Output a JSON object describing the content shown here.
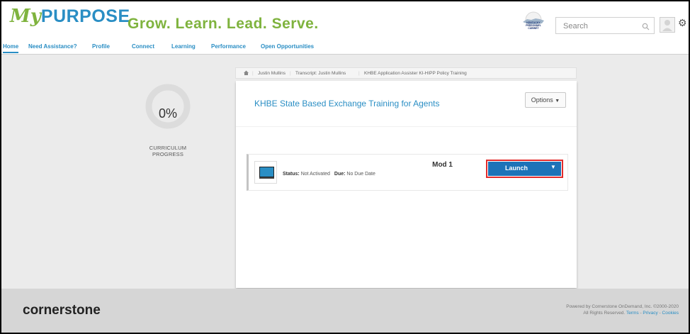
{
  "header": {
    "logo_my": "My",
    "logo_purpose": "PURPOSE",
    "tagline": "Grow. Learn. Lead. Serve.",
    "seal_text": [
      "KENTUCKY",
      "PERSONNEL",
      "CABINET"
    ],
    "search_placeholder": "Search"
  },
  "nav": [
    "Home",
    "Need Assistance?",
    "Profile",
    "Connect",
    "Learning",
    "Performance",
    "Open Opportunities"
  ],
  "progress": {
    "value": "0%",
    "label": "CURRICULUM PROGRESS"
  },
  "breadcrumb": [
    "Justin Mullins",
    "Transcript: Justin Mullins",
    "KHBE Application Assister KI-HIPP Policy Training"
  ],
  "card": {
    "title": "KHBE State Based Exchange Training for Agents",
    "options_label": "Options"
  },
  "module": {
    "name": "Mod 1",
    "status_label": "Status:",
    "status_value": "Not Activated",
    "due_label": "Due:",
    "due_value": "No Due Date",
    "launch_label": "Launch"
  },
  "footer": {
    "brand": "cornerstone",
    "line1": "Powered by Cornerstone OnDemand, Inc. ©2000-2020",
    "line2_prefix": "All Rights Reserved.",
    "terms": "Terms",
    "privacy": "Privacy",
    "cookies": "Cookies"
  },
  "colors": {
    "brand_blue": "#2a8ec4",
    "brand_green": "#7fb33e",
    "launch_blue": "#1d73b8",
    "highlight_red": "#e32b2b"
  }
}
